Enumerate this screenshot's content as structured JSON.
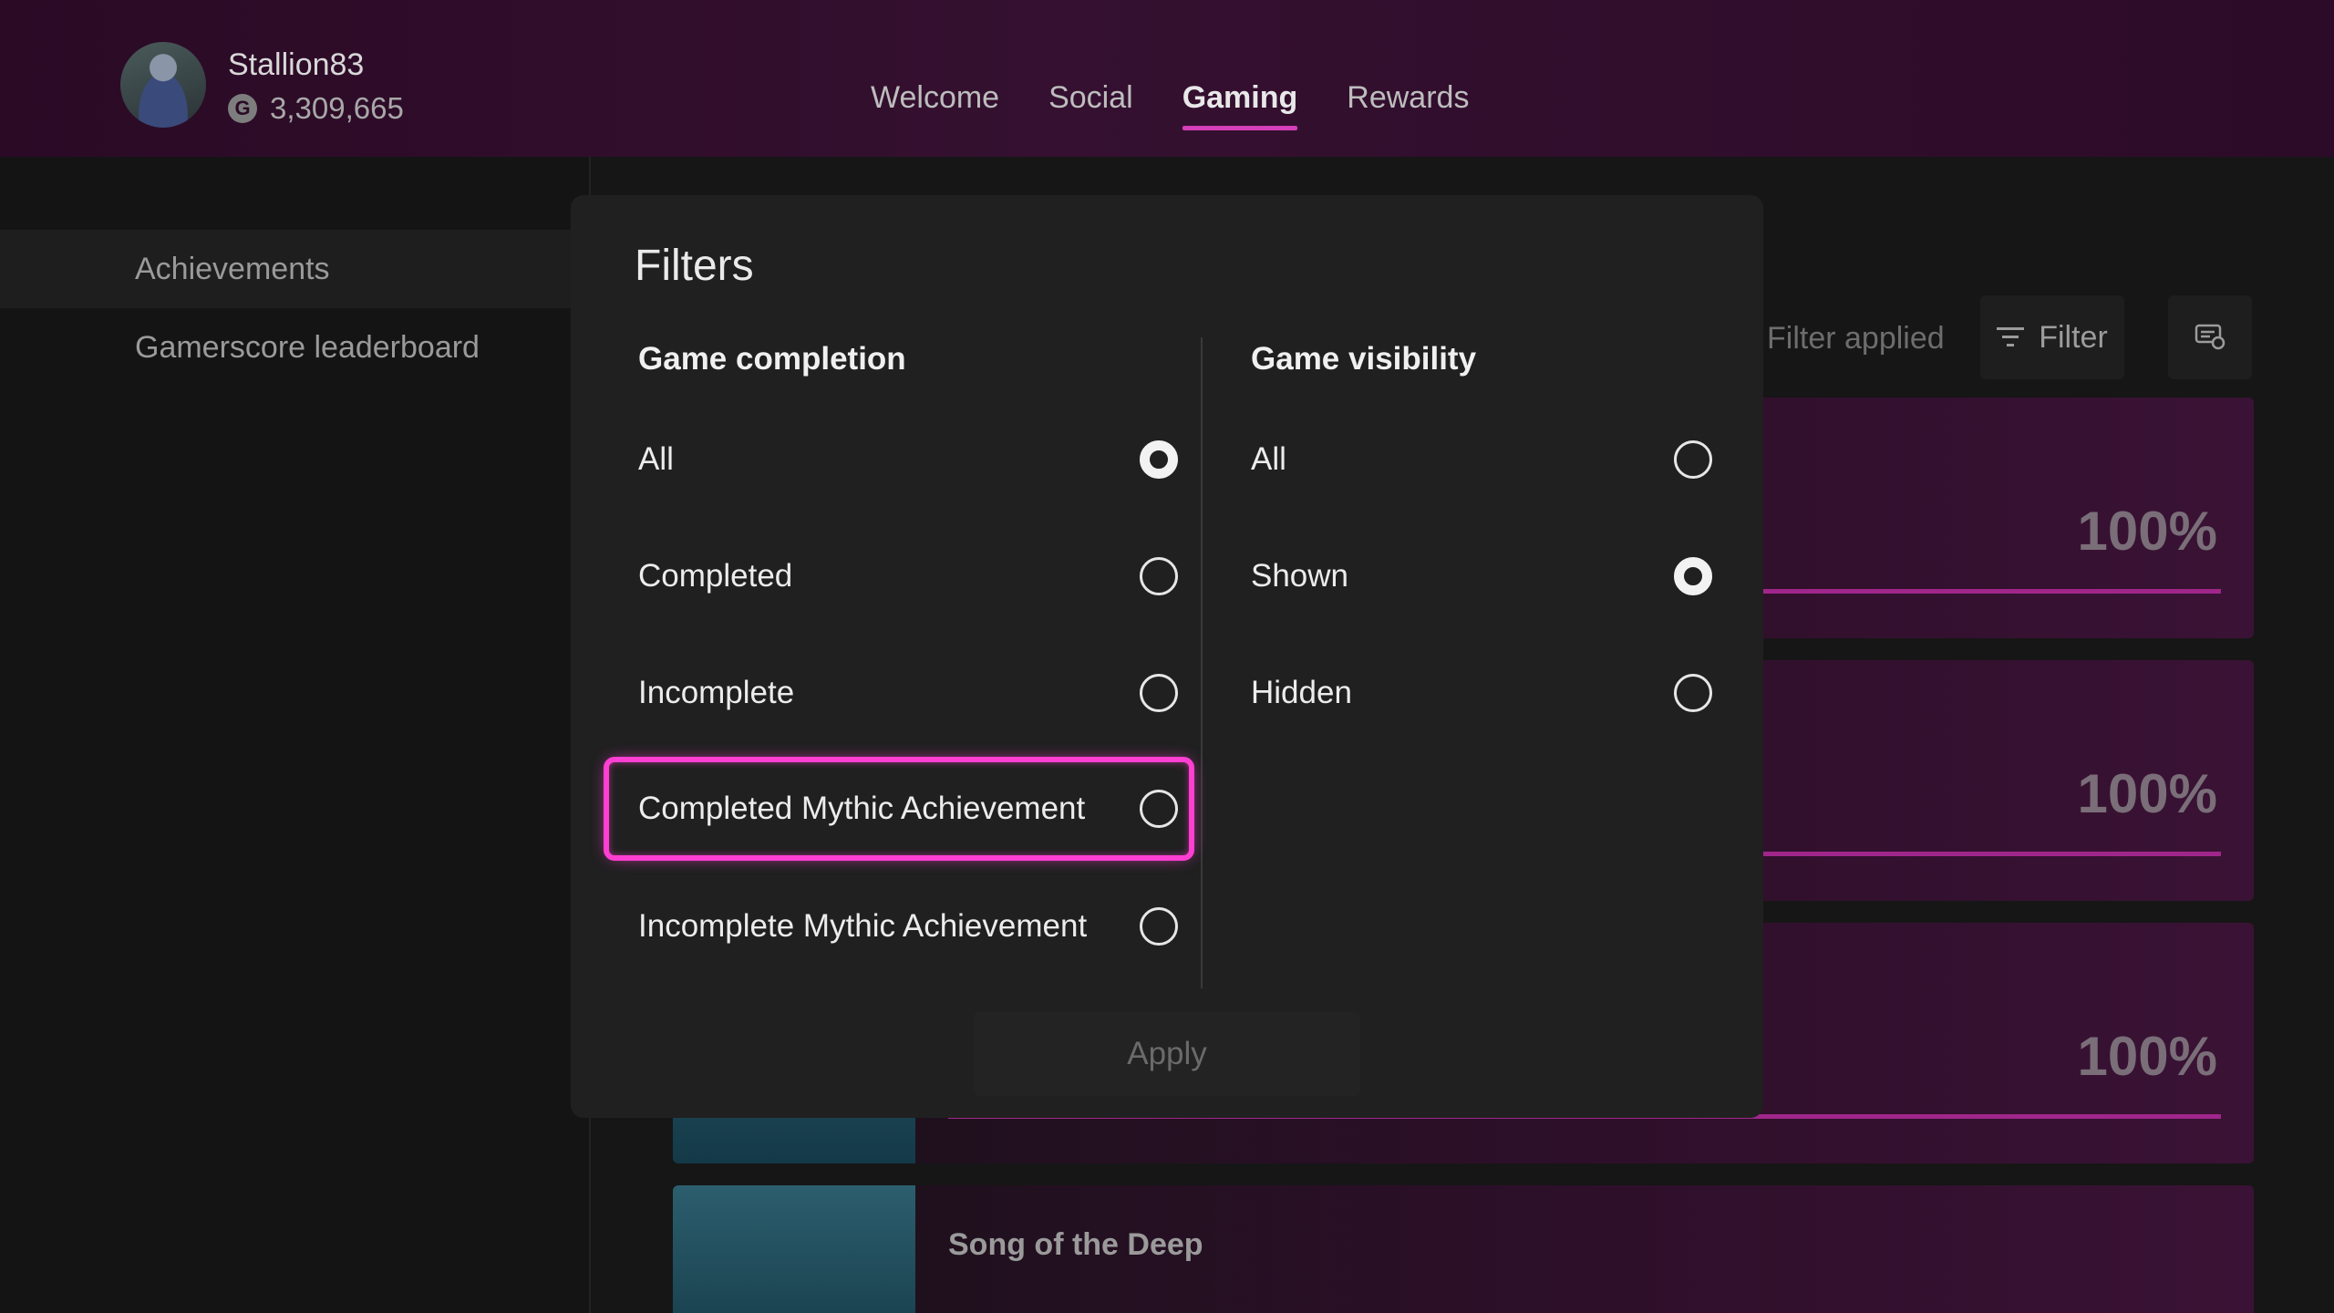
{
  "header": {
    "gamertag": "Stallion83",
    "gamerscore": "3,309,665",
    "gamerscore_icon_letter": "G",
    "tabs": [
      {
        "label": "Welcome"
      },
      {
        "label": "Social"
      },
      {
        "label": "Gaming",
        "active": true
      },
      {
        "label": "Rewards"
      }
    ]
  },
  "sidebar": {
    "items": [
      {
        "label": "Achievements",
        "selected": true
      },
      {
        "label": "Gamerscore leaderboard"
      }
    ]
  },
  "toolbar": {
    "filter_status": "Filter applied",
    "filter_label": "Filter"
  },
  "games": [
    {
      "percent": "100%"
    },
    {
      "percent": "100%"
    },
    {
      "percent": "100%"
    },
    {
      "title": "Song of the Deep"
    }
  ],
  "dialog": {
    "title": "Filters",
    "completion": {
      "heading": "Game completion",
      "options": [
        {
          "label": "All",
          "selected": true
        },
        {
          "label": "Completed"
        },
        {
          "label": "Incomplete"
        },
        {
          "label": "Completed Mythic Achievement",
          "focused": true
        },
        {
          "label": "Incomplete Mythic Achievement"
        }
      ]
    },
    "visibility": {
      "heading": "Game visibility",
      "options": [
        {
          "label": "All"
        },
        {
          "label": "Shown",
          "selected": true
        },
        {
          "label": "Hidden"
        }
      ]
    },
    "apply_label": "Apply"
  },
  "colors": {
    "accent": "#d53fb8",
    "focus": "#ff3fd2",
    "header_bg": "#351030",
    "dialog_bg": "#202020"
  }
}
